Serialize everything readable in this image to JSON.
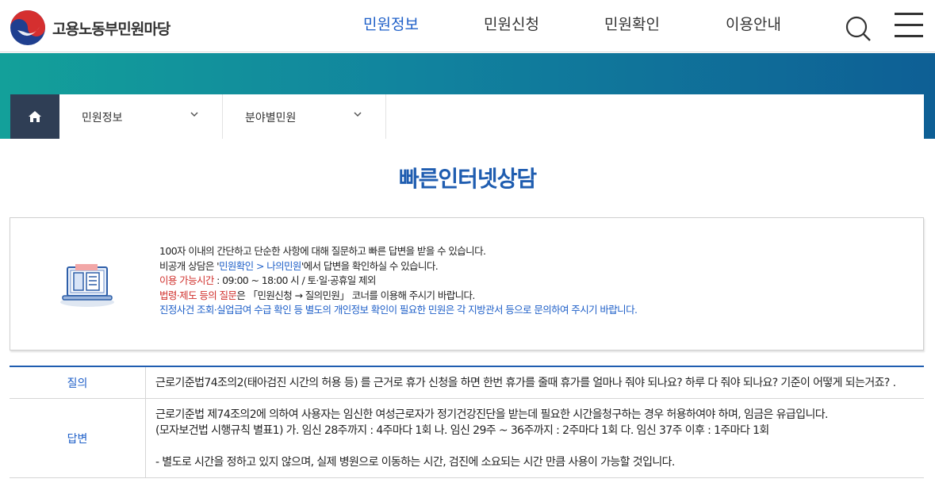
{
  "header": {
    "logo_text": "고용노동부민원마당",
    "nav": [
      {
        "label": "민원정보",
        "active": true
      },
      {
        "label": "민원신청",
        "active": false
      },
      {
        "label": "민원확인",
        "active": false
      },
      {
        "label": "이용안내",
        "active": false
      }
    ],
    "icons": {
      "search": "search-icon",
      "menu": "hamburger-menu-icon"
    }
  },
  "breadcrumb": {
    "home_icon": "home-icon",
    "items": [
      {
        "label": "민원정보"
      },
      {
        "label": "분야별민원"
      }
    ]
  },
  "page_title": "빠른인터넷상담",
  "info": {
    "line1": "100자 이내의 간단하고 단순한 사항에 대해 질문하고 빠른 답변을 받을 수 있습니다.",
    "line2_pre": "비공개 상담은 '",
    "line2_link": "민원확인 > 나의민원",
    "line2_post": "'에서 답변을 확인하실 수 있습니다.",
    "line3_label": "이용 가능시간",
    "line3_text": " : 09:00 ~ 18:00 시 / 토·일·공휴일 제외",
    "line4_label": "법령·제도 등의 질문",
    "line4_text": "은 「민원신청 → 질의민원」 코너를 이용해 주시기 바랍니다.",
    "line5": "진정사건 조회·실업급여 수급 확인 등 별도의 개인정보 확인이 필요한 민원은 각 지방관서 등으로 문의하여 주시기 바랍니다."
  },
  "qa": {
    "question_label": "질의",
    "question": "근로기준법74조의2(태아검진 시간의 허용 등) 를 근거로 휴가 신청을 하면 한번 휴가를 줄때 휴가를 얼마나 줘야 되나요? 하루 다 줘야 되나요? 기준이 어떻게 되는거죠? .",
    "answer_label": "답변",
    "answer_line1": "근로기준법 제74조의2에 의하여 사용자는 임신한 여성근로자가 정기건강진단을 받는데 필요한 시간을청구하는 경우 허용하여야 하며, 임금은 유급입니다.",
    "answer_line2": "(모자보건법 시행규칙 별표1) 가. 임신 28주까지 : 4주마다 1회 나. 임신 29주 ~ 36주까지 : 2주마다 1회 다. 임신 37주 이후 : 1주마다 1회",
    "answer_line3": "- 별도로 시간을 정하고 있지 않으며, 실제 병원으로 이동하는 시간, 검진에 소요되는 시간 만큼 사용이 가능할 것입니다."
  },
  "colors": {
    "accent": "#1f5db0",
    "link": "#1e5fc8",
    "warn": "#d0312d",
    "home_bg": "#2f3e55",
    "banner_start": "#13a09a",
    "banner_end": "#0e5f95"
  }
}
